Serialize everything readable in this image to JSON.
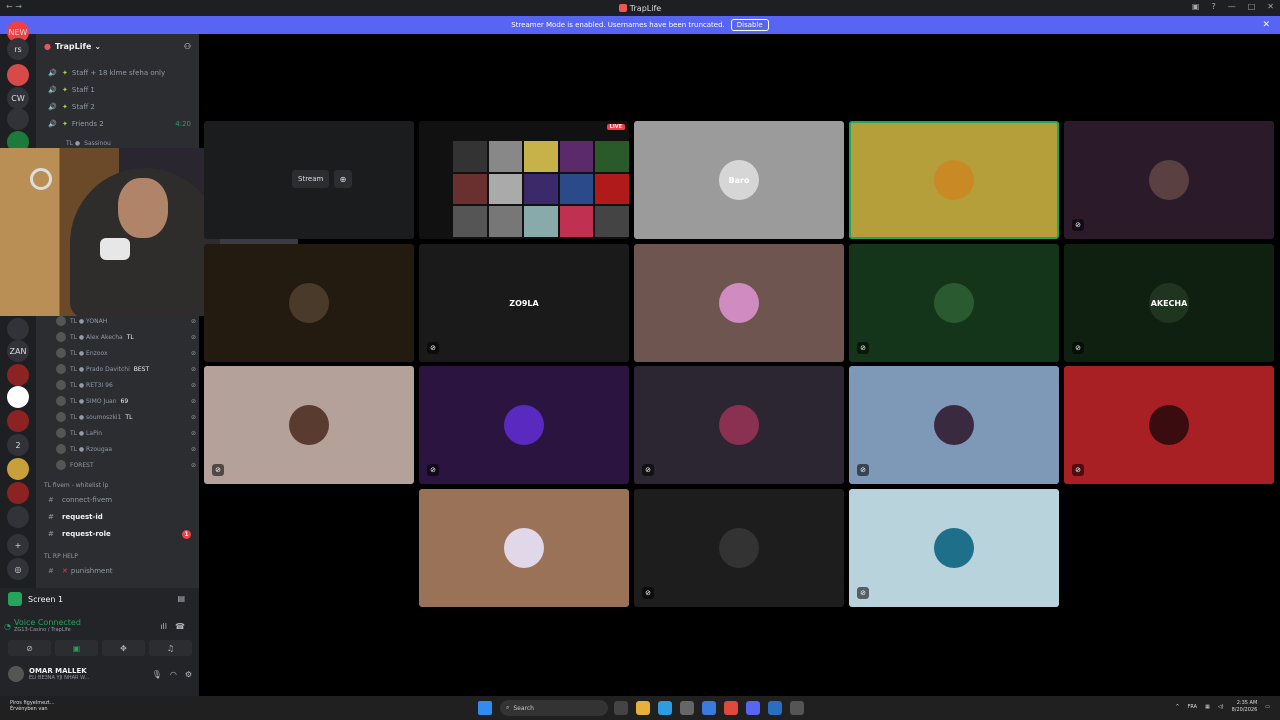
{
  "window": {
    "title": "TrapLife"
  },
  "banner": {
    "text": "Streamer Mode is enabled. Usernames have been truncated.",
    "disable_label": "Disable"
  },
  "rail": [
    {
      "label": "NEW",
      "color": "#f23f43"
    },
    {
      "label": "rs",
      "color": "#313338"
    },
    {
      "label": "",
      "badge": "344",
      "color": "#d64a4a"
    },
    {
      "label": "CW",
      "color": "#313338"
    },
    {
      "label": "",
      "badge": "116",
      "color": "#313338"
    },
    {
      "label": "",
      "color": "#1c7a3b"
    }
  ],
  "rail_lower": [
    {
      "label": "",
      "badge": "114",
      "color": "#313338"
    },
    {
      "label": "ZAN",
      "badge": "305",
      "color": "#313338"
    },
    {
      "label": "",
      "color": "#8b2323"
    },
    {
      "label": "",
      "color": "#ffffff"
    },
    {
      "label": "",
      "badge": "385",
      "color": "#8b2323"
    },
    {
      "label": "2",
      "color": "#313338"
    },
    {
      "label": "",
      "badge": "99",
      "color": "#c7a03b"
    },
    {
      "label": "",
      "badge": "48",
      "color": "#8b2323"
    },
    {
      "label": "",
      "badge": "2K+",
      "color": "#313338"
    },
    {
      "label": "+",
      "color": "#313338"
    },
    {
      "label": "◎",
      "color": "#313338"
    }
  ],
  "guild": {
    "name": "TrapLife"
  },
  "voice_channels_top": [
    {
      "name": "Staff + 18 klme sfeha only"
    },
    {
      "name": "Staff 1"
    },
    {
      "name": "Staff 2"
    },
    {
      "name": "Friends 2",
      "time": "4:20"
    }
  ],
  "top_member": "Sassinou",
  "members": [
    {
      "name": "TL ● YONAH",
      "icon": "mic-off"
    },
    {
      "name": "TL ● Alex Akecha",
      "tag": "TL",
      "icon": "mic-off"
    },
    {
      "name": "TL ● Enzoox",
      "icon": "mic-off"
    },
    {
      "name": "TL ● Prado Davitchi",
      "tag": "BEST",
      "icon": "mic-off"
    },
    {
      "name": "TL ● RET3I 96",
      "icon": "mic-off"
    },
    {
      "name": "TL ● SIMO Juan",
      "tag": "69",
      "icon": "mic-off"
    },
    {
      "name": "TL ● soumoszki1",
      "tag": "TL",
      "icon": "mic-off"
    },
    {
      "name": "TL ● LaPin",
      "icon": "mic-off"
    },
    {
      "name": "TL ● Rzougaa",
      "icon": "mic-off"
    },
    {
      "name": "FOREST",
      "icon": "mic-off"
    }
  ],
  "category_fivem": "TL fivem - whitelist lp",
  "text_channels": [
    {
      "name": "connect-fivem",
      "bold": false
    },
    {
      "name": "request-id",
      "bold": true
    },
    {
      "name": "request-role",
      "bold": true,
      "unread": "1"
    }
  ],
  "category_help": "TL RP HELP",
  "help_channel": "punishment",
  "stream": {
    "label": "Stream"
  },
  "voice_panel": {
    "screen_label": "Screen 1",
    "status": "Voice Connected",
    "channel": "ZG13-Casino / TrapLife"
  },
  "user": {
    "name": "OMAR MALLEK",
    "status": "ELI BE3NA YJI NHAR W..."
  },
  "tiles": [
    {
      "bg": "#1a1c1e",
      "kind": "stream"
    },
    {
      "bg": "#111111",
      "kind": "live",
      "live_label": "LIVE"
    },
    {
      "bg": "#9b9b9b",
      "avatar": "#d6d6d6",
      "text": "Baro"
    },
    {
      "bg": "#b59f3b",
      "avatar": "#c98a25",
      "text": "",
      "highlight": true
    },
    {
      "bg": "#2a1a2a",
      "avatar": "#5a4040",
      "text": "",
      "muted": true
    },
    {
      "bg": "#231a10",
      "avatar": "#4a3a2a",
      "text": ""
    },
    {
      "bg": "#1a1a1a",
      "avatar": "#1a1a1a",
      "text": "ZO9LA",
      "muted": true
    },
    {
      "bg": "#6e5550",
      "avatar": "#d08bc0",
      "text": ""
    },
    {
      "bg": "#14351a",
      "avatar": "#2a5a30",
      "text": "",
      "muted": true
    },
    {
      "bg": "#102010",
      "avatar": "#203520",
      "text": "AKECHA",
      "muted": true
    },
    {
      "bg": "#b4a19a",
      "avatar": "#5a3b30",
      "text": "",
      "muted": true
    },
    {
      "bg": "#2b1440",
      "avatar": "#5a2ac0",
      "text": "",
      "muted": true
    },
    {
      "bg": "#2c2632",
      "avatar": "#8a3050",
      "text": "",
      "muted": true
    },
    {
      "bg": "#7e98b8",
      "avatar": "#3a2a40",
      "text": "",
      "muted": true
    },
    {
      "bg": "#a81f24",
      "avatar": "#3b0c0f",
      "text": "",
      "muted": true
    },
    {
      "bg": "#9a7258",
      "avatar": "#e0d8e8",
      "text": ""
    },
    {
      "bg": "#1d1d1d",
      "avatar": "#333333",
      "text": "",
      "muted": true
    },
    {
      "bg": "#b9d3dc",
      "avatar": "#1d6f8a",
      "text": "",
      "muted": true
    }
  ],
  "taskbar": {
    "weather_title": "Piros figyelmezt...",
    "weather_sub": "Érvényben van",
    "search": "Search",
    "lang": "FRA",
    "time": "2:35 AM",
    "date": "8/20/2026"
  },
  "colors": {
    "accent": "#5865f2",
    "voice_green": "#23a55a",
    "alert": "#f23f43"
  }
}
